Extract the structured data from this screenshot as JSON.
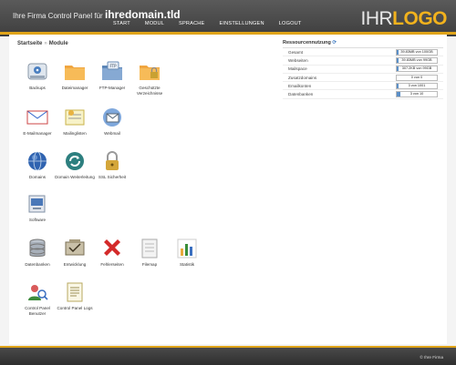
{
  "header": {
    "title_prefix": "Ihre Firma Control Panel für",
    "title_domain": "ihredomain.tld",
    "logo_part1": "IHR",
    "logo_part2": "LOGO",
    "nav": [
      "START",
      "MODUL",
      "SPRACHE",
      "EINSTELLUNGEN",
      "LOGOUT"
    ]
  },
  "breadcrumb": {
    "home": "Startseite",
    "separator": "»",
    "current": "Module"
  },
  "modules": [
    {
      "label": "Backups",
      "icon": "backup-drive-icon"
    },
    {
      "label": "Dateimanager",
      "icon": "folder-icon"
    },
    {
      "label": "FTP-Manager",
      "icon": "ftp-folder-icon"
    },
    {
      "label": "Geschützte Verzeichnisse",
      "icon": "protected-folder-icon"
    },
    {
      "label": "E-Mailmanager",
      "icon": "mail-envelope-icon"
    },
    {
      "label": "Mailinglisten",
      "icon": "mailinglist-icon"
    },
    {
      "label": "Webmail",
      "icon": "webmail-icon"
    },
    {
      "label": "Domains",
      "icon": "globe-icon"
    },
    {
      "label": "Domain Weiterleitung",
      "icon": "redirect-icon"
    },
    {
      "label": "SSL Sicherheit",
      "icon": "padlock-icon"
    },
    {
      "label": "Software",
      "icon": "software-box-icon"
    },
    {
      "label": "Datenbanken",
      "icon": "database-icon"
    },
    {
      "label": "Entwicklung",
      "icon": "development-tools-icon"
    },
    {
      "label": "Fehlerseiten",
      "icon": "error-x-icon"
    },
    {
      "label": "Filemap",
      "icon": "filemap-document-icon"
    },
    {
      "label": "Statistik",
      "icon": "statistics-chart-icon"
    },
    {
      "label": "Control Panel Benutzer",
      "icon": "users-search-icon"
    },
    {
      "label": "Control Panel Logs",
      "icon": "logs-document-icon"
    }
  ],
  "resources": {
    "title": "Ressourcennutzung",
    "rows": [
      {
        "label": "Gesamt",
        "value": "39.83MB von 100GB",
        "fill": 0.02
      },
      {
        "label": "Webseiten",
        "value": "39.83MB von 99GB",
        "fill": 0.02
      },
      {
        "label": "Mailspace",
        "value": "307.2KB von 99GB",
        "fill": 0.01
      },
      {
        "label": "Zusatzdomains",
        "value": "0 von 0",
        "fill": 0
      },
      {
        "label": "Emailkonten",
        "value": "3 von 1001",
        "fill": 0.01
      },
      {
        "label": "Datenbanken",
        "value": "3 von 10",
        "fill": 0.08
      }
    ]
  },
  "footer": {
    "text": "© Ihre Firma"
  },
  "colors": {
    "accent": "#e0a419",
    "header": "#4a4a4a",
    "logo_accent": "#f2b21d"
  }
}
